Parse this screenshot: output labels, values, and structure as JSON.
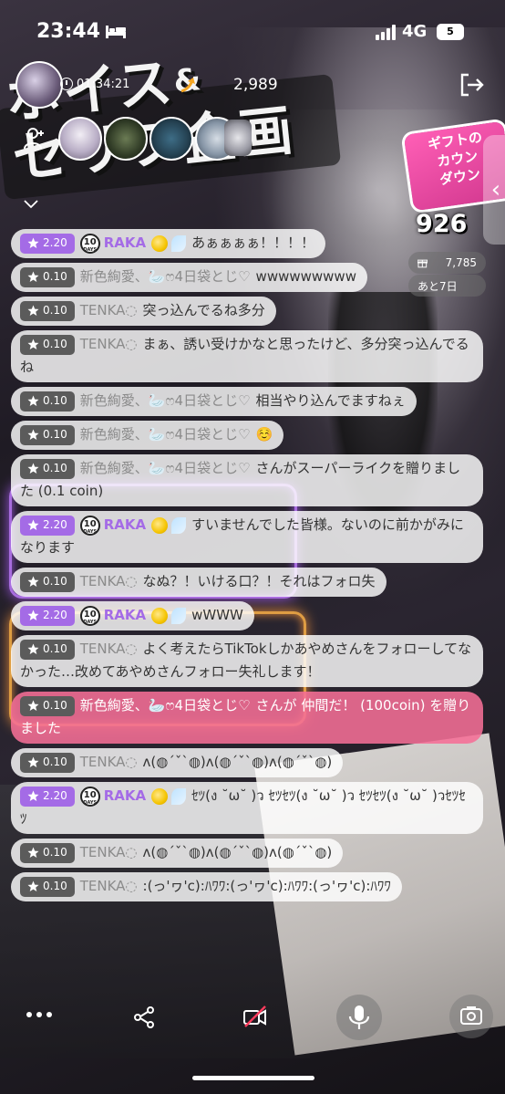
{
  "status": {
    "time": "23:44",
    "network": "4G",
    "battery": "5"
  },
  "header": {
    "timer": "01:34:21",
    "viewers": "2,989",
    "gift_badge": [
      "ギフトの",
      "カウン",
      "ダウン"
    ],
    "big_count": "926",
    "stat_coins": "7,785",
    "stat_days": "あと7日"
  },
  "background_art": {
    "headline_line1": "ボイス",
    "headline_amp": "&",
    "headline_line2": "セリフ企画",
    "accent_purple": "#c07bff",
    "accent_orange": "#ffb347"
  },
  "comments": [
    {
      "level": "2.20",
      "style": "purple",
      "days": true,
      "user": "RAKA",
      "emoji": true,
      "text": "あぁぁぁぁ！！！！"
    },
    {
      "level": "0.10",
      "style": "gray",
      "days": false,
      "user": "新色絢愛、🦢ෆ4日袋とじ♡",
      "emoji": false,
      "text": "wwwwwwwww"
    },
    {
      "level": "0.10",
      "style": "gray",
      "days": false,
      "user": "TENKA◌",
      "emoji": false,
      "text": "突っ込んでるね多分"
    },
    {
      "level": "0.10",
      "style": "gray",
      "days": false,
      "user": "TENKA◌",
      "emoji": false,
      "text": "まぁ、誘い受けかなと思ったけど、多分突っ込んでるね"
    },
    {
      "level": "0.10",
      "style": "gray",
      "days": false,
      "user": "新色絢愛、🦢ෆ4日袋とじ♡",
      "emoji": false,
      "text": "相当やり込んでますねぇ"
    },
    {
      "level": "0.10",
      "style": "gray",
      "days": false,
      "user": "新色絢愛、🦢ෆ4日袋とじ♡",
      "emoji": false,
      "text": "☺️"
    },
    {
      "level": "0.10",
      "style": "gray",
      "days": false,
      "user": "新色絢愛、🦢ෆ4日袋とじ♡",
      "emoji": false,
      "text": "さんがスーパーライクを贈りました (0.1 coin)"
    },
    {
      "level": "2.20",
      "style": "purple",
      "days": true,
      "user": "RAKA",
      "emoji": true,
      "text": "すいませんでした皆様。ないのに前かがみになります"
    },
    {
      "level": "0.10",
      "style": "gray",
      "days": false,
      "user": "TENKA◌",
      "emoji": false,
      "text": "なぬ？！いける口？！それはフォロ失"
    },
    {
      "level": "2.20",
      "style": "purple",
      "days": true,
      "user": "RAKA",
      "emoji": true,
      "text": "wWWW"
    },
    {
      "level": "0.10",
      "style": "gray",
      "days": false,
      "user": "TENKA◌",
      "emoji": false,
      "text": "よく考えたらTikTokしかあやめさんをフォローしてなかった…改めてあやめさんフォロー失礼します！"
    },
    {
      "level": "0.10",
      "style": "pink",
      "days": false,
      "user": "新色絢愛、🦢ෆ4日袋とじ♡",
      "emoji": false,
      "text": "さんが 仲間だ！ (100coin) を贈りました"
    },
    {
      "level": "0.10",
      "style": "gray",
      "days": false,
      "user": "TENKA◌",
      "emoji": false,
      "text": "ʌ(◍´ˇ`◍)ʌ(◍´ˇ`◍)ʌ(◍´ˇ`◍)"
    },
    {
      "level": "2.20",
      "style": "purple",
      "days": true,
      "user": "RAKA",
      "emoji": true,
      "text": "ｾﾂ(ง ˘ω˘ )ว ｾﾂｾﾂ(ง ˘ω˘ )ว ｾﾂｾﾂ(ง ˘ω˘ )วｾﾂｾﾂ"
    },
    {
      "level": "0.10",
      "style": "gray",
      "days": false,
      "user": "TENKA◌",
      "emoji": false,
      "text": "ʌ(◍´ˇ`◍)ʌ(◍´ˇ`◍)ʌ(◍´ˇ`◍)"
    },
    {
      "level": "0.10",
      "style": "gray",
      "days": false,
      "user": "TENKA◌",
      "emoji": false,
      "text": ":(っ'ヮ'c):ﾊﾜﾜ:(っ'ヮ'c):ﾊﾜﾜ:(っ'ヮ'c):ﾊﾜﾜ"
    }
  ],
  "days_badge": {
    "num": "10",
    "label": "DAYS"
  }
}
